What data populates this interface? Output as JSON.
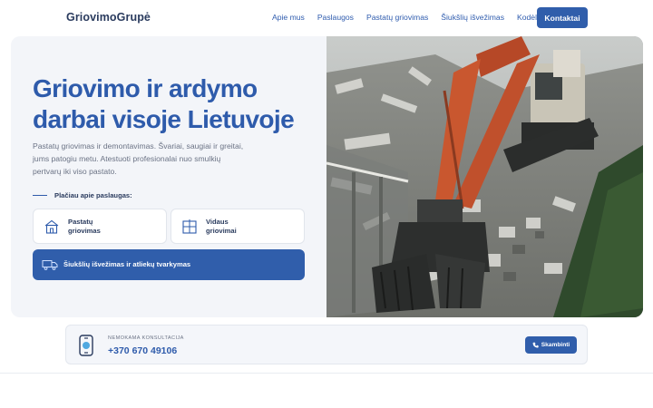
{
  "header": {
    "logo": "GriovimoGrupė",
    "nav": [
      {
        "label": "Apie mus"
      },
      {
        "label": "Paslaugos"
      },
      {
        "label": "Pastatų griovimas"
      },
      {
        "label": "Šiukšlių išvežimas"
      },
      {
        "label": "Kodėl mes"
      }
    ],
    "contact_label": "Kontaktai"
  },
  "hero": {
    "title_line1": "Griovimo ir ardymo",
    "title_line2": "darbai visoje Lietuvoje",
    "lead_line1": "Pastatų griovimas ir demontavimas. Švariai, saugiai ir greitai,",
    "lead_line2": "jums patogiu metu. Atestuoti profesionalai nuo smulkių",
    "lead_line3": "pertvarų iki viso pastato.",
    "more_label": "Plačiau apie paslaugas:",
    "services": [
      {
        "line1": "Pastatų",
        "line2": "griovimas",
        "icon": "house-icon"
      },
      {
        "line1": "Vidaus",
        "line2": "griovimai",
        "icon": "interior-icon"
      }
    ],
    "wide_service": {
      "label": "Šiukšlių išvežimas ir atliekų tvarkymas",
      "icon": "truck-icon"
    }
  },
  "consult": {
    "caption": "NEMOKAMA KONSULTACIJA",
    "phone": "+370 670 49106",
    "call_label": "Skambinti",
    "icon": "phone-icon"
  },
  "colors": {
    "accent": "#305eab",
    "title": "#2e5bab",
    "text": "#6b7385"
  }
}
